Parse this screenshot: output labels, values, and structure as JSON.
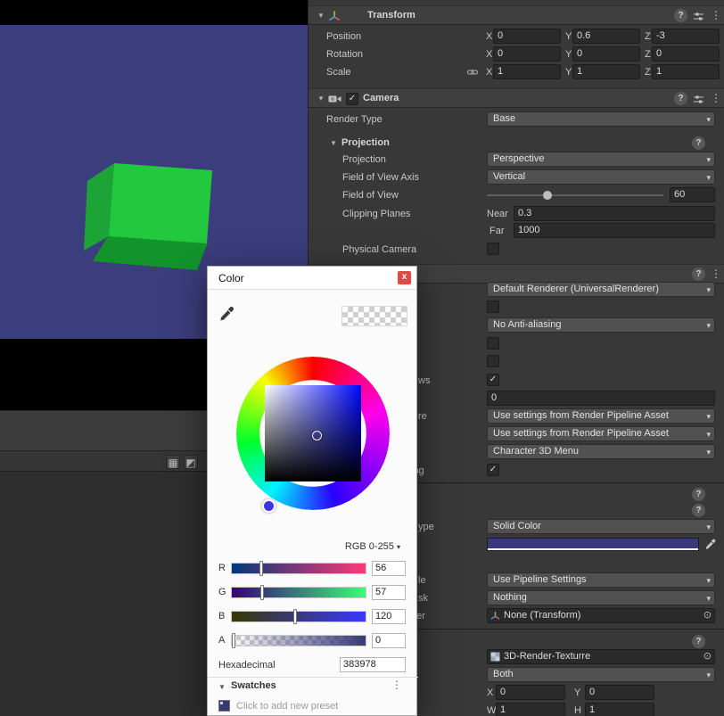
{
  "icons": {
    "help": "?",
    "kebab": "⋮",
    "fold": "▼",
    "dropdown_arrow": "▾",
    "picker": "⊙",
    "check": "✓",
    "grid": "▦",
    "half_square": "◩"
  },
  "colors": {
    "viewport_background": "#3b3d7c",
    "cube_green": "#22c93e",
    "picked_color_hex": "#383978"
  },
  "inspector": {
    "transform": {
      "title": "Transform",
      "axis": {
        "x": "X",
        "y": "Y",
        "z": "Z"
      },
      "rows": [
        {
          "label": "Position",
          "x": "0",
          "y": "0.6",
          "z": "-3"
        },
        {
          "label": "Rotation",
          "x": "0",
          "y": "0",
          "z": "0"
        },
        {
          "label": "Scale",
          "x": "1",
          "y": "1",
          "z": "1"
        }
      ]
    },
    "camera": {
      "title": "Camera",
      "render_type": {
        "label": "Render Type",
        "value": "Base"
      },
      "projection_section": "Projection",
      "projection": {
        "label": "Projection",
        "value": "Perspective"
      },
      "fov_axis": {
        "label": "Field of View Axis",
        "value": "Vertical"
      },
      "fov": {
        "label": "Field of View",
        "value": "60"
      },
      "clipping": {
        "label": "Clipping Planes",
        "near_label": "Near",
        "near": "0.3",
        "far_label": "Far",
        "far": "1000"
      },
      "physical": {
        "label": "Physical Camera"
      }
    },
    "rendering": {
      "renderer": "Default Renderer (UniversalRenderer)",
      "antialiasing": "No Anti-aliasing",
      "shadows_fragment": "ws",
      "priority": "0",
      "depth_fragment": "re",
      "pipeline_setting_1": "Use settings from Render Pipeline Asset",
      "pipeline_setting_2": "Use settings from Render Pipeline Asset",
      "culling": "Character 3D Menu",
      "occlusion_fragment": "ing"
    },
    "environment": {
      "bg_type_fragment": "ype",
      "bg_type": "Solid Color",
      "volume_fragment": "le",
      "volume_mode": "Use Pipeline Settings",
      "mask_fragment": "sk",
      "mask": "Nothing",
      "trigger_fragment": "ger",
      "trigger": "None (Transform)"
    },
    "output": {
      "texture": "3D-Render-Texturre",
      "eye": "Both",
      "x_label": "X",
      "x": "0",
      "y_label": "Y",
      "y": "0",
      "w_label": "W",
      "w": "1",
      "h_label": "H",
      "h": "1"
    }
  },
  "color_window": {
    "title": "Color",
    "close": "x",
    "mode": "RGB 0-255",
    "sliders": [
      {
        "label": "R",
        "value": "56"
      },
      {
        "label": "G",
        "value": "57"
      },
      {
        "label": "B",
        "value": "120"
      },
      {
        "label": "A",
        "value": "0"
      }
    ],
    "hex_label": "Hexadecimal",
    "hex": "383978",
    "swatches_label": "Swatches",
    "preset_hint": "Click to add new preset"
  }
}
